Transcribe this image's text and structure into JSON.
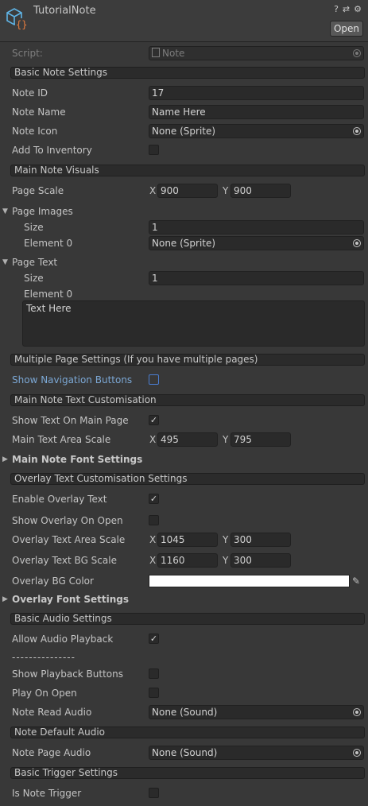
{
  "header": {
    "title": "TutorialNote",
    "open_label": "Open",
    "help_icon": "?",
    "preset_icon": "⇄",
    "settings_icon": "⚙"
  },
  "script": {
    "label": "Script:",
    "value": "Note"
  },
  "basic_note": {
    "section": "Basic Note Settings",
    "note_id_label": "Note ID",
    "note_id": "17",
    "note_name_label": "Note Name",
    "note_name": "Name Here",
    "note_icon_label": "Note Icon",
    "note_icon": "None (Sprite)",
    "add_inventory_label": "Add To Inventory",
    "add_inventory": false
  },
  "visuals": {
    "section": "Main Note Visuals",
    "page_scale_label": "Page Scale",
    "page_scale_x": "900",
    "page_scale_y": "900",
    "page_images_label": "Page Images",
    "page_images_size_label": "Size",
    "page_images_size": "1",
    "page_images_el0_label": "Element 0",
    "page_images_el0": "None (Sprite)",
    "page_text_label": "Page Text",
    "page_text_size_label": "Size",
    "page_text_size": "1",
    "page_text_el0_label": "Element 0",
    "page_text_el0": "Text Here"
  },
  "multipage": {
    "section": "Multiple Page Settings (If you have multiple pages)",
    "show_nav_label": "Show Navigation Buttons",
    "show_nav": false
  },
  "main_text": {
    "section": "Main Note Text Customisation",
    "show_text_label": "Show Text On Main Page",
    "show_text": true,
    "area_scale_label": "Main Text Area Scale",
    "area_x": "495",
    "area_y": "795",
    "font_settings_label": "Main Note Font Settings"
  },
  "overlay": {
    "section": "Overlay Text Customisation Settings",
    "enable_label": "Enable Overlay Text",
    "enable": true,
    "show_open_label": "Show Overlay On Open",
    "show_open": false,
    "area_label": "Overlay Text Area Scale",
    "area_x": "1045",
    "area_y": "300",
    "bg_scale_label": "Overlay Text BG Scale",
    "bg_x": "1160",
    "bg_y": "300",
    "bg_color_label": "Overlay BG Color",
    "bg_color": "#ffffff",
    "font_settings_label": "Overlay Font Settings"
  },
  "audio": {
    "section": "Basic Audio Settings",
    "allow_label": "Allow Audio Playback",
    "allow": true,
    "separator": "---------------",
    "show_playback_label": "Show Playback Buttons",
    "show_playback": false,
    "play_open_label": "Play On Open",
    "play_open": false,
    "read_audio_label": "Note Read Audio",
    "read_audio": "None (Sound)"
  },
  "default_audio": {
    "section": "Note Default Audio",
    "page_audio_label": "Note Page Audio",
    "page_audio": "None (Sound)"
  },
  "trigger": {
    "section": "Basic Trigger Settings",
    "is_trigger_label": "Is Note Trigger",
    "is_trigger": false
  },
  "axis": {
    "x": "X",
    "y": "Y"
  },
  "check_mark": "✓"
}
